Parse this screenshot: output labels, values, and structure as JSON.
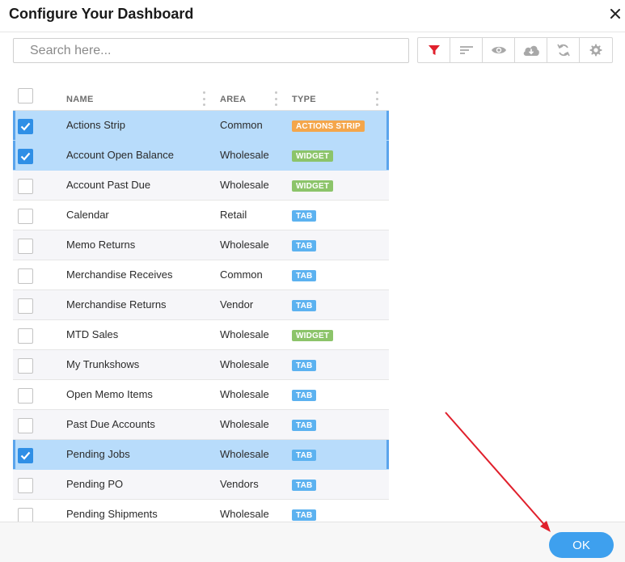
{
  "dialog": {
    "title": "Configure Your Dashboard"
  },
  "search": {
    "placeholder": "Search here...",
    "value": ""
  },
  "toolbar": {
    "buttons": [
      {
        "icon": "filter-icon",
        "active_color": "#e0202c"
      },
      {
        "icon": "sort-icon"
      },
      {
        "icon": "eye-icon"
      },
      {
        "icon": "cloud-download-icon"
      },
      {
        "icon": "refresh-icon"
      },
      {
        "icon": "settings-icon"
      }
    ]
  },
  "grid": {
    "columns": {
      "name": "NAME",
      "area": "AREA",
      "type": "TYPE"
    },
    "rows": [
      {
        "name": "Actions Strip",
        "area": "Common",
        "type": "ACTIONS STRIP",
        "type_kind": "strip",
        "checked": true
      },
      {
        "name": "Account Open Balance",
        "area": "Wholesale",
        "type": "WIDGET",
        "type_kind": "widget",
        "checked": true
      },
      {
        "name": "Account Past Due",
        "area": "Wholesale",
        "type": "WIDGET",
        "type_kind": "widget",
        "checked": false
      },
      {
        "name": "Calendar",
        "area": "Retail",
        "type": "TAB",
        "type_kind": "tab",
        "checked": false
      },
      {
        "name": "Memo Returns",
        "area": "Wholesale",
        "type": "TAB",
        "type_kind": "tab",
        "checked": false
      },
      {
        "name": "Merchandise Receives",
        "area": "Common",
        "type": "TAB",
        "type_kind": "tab",
        "checked": false
      },
      {
        "name": "Merchandise Returns",
        "area": "Vendor",
        "type": "TAB",
        "type_kind": "tab",
        "checked": false
      },
      {
        "name": "MTD Sales",
        "area": "Wholesale",
        "type": "WIDGET",
        "type_kind": "widget",
        "checked": false
      },
      {
        "name": "My Trunkshows",
        "area": "Wholesale",
        "type": "TAB",
        "type_kind": "tab",
        "checked": false
      },
      {
        "name": "Open Memo Items",
        "area": "Wholesale",
        "type": "TAB",
        "type_kind": "tab",
        "checked": false
      },
      {
        "name": "Past Due Accounts",
        "area": "Wholesale",
        "type": "TAB",
        "type_kind": "tab",
        "checked": false
      },
      {
        "name": "Pending Jobs",
        "area": "Wholesale",
        "type": "TAB",
        "type_kind": "tab",
        "checked": true
      },
      {
        "name": "Pending PO",
        "area": "Vendors",
        "type": "TAB",
        "type_kind": "tab",
        "checked": false
      },
      {
        "name": "Pending Shipments",
        "area": "Wholesale",
        "type": "TAB",
        "type_kind": "tab",
        "checked": false
      }
    ]
  },
  "footer": {
    "ok_label": "OK"
  },
  "colors": {
    "accent": "#3ea0ee",
    "selected_row": "#b8dcfb",
    "annotation_arrow": "#e0202c"
  }
}
